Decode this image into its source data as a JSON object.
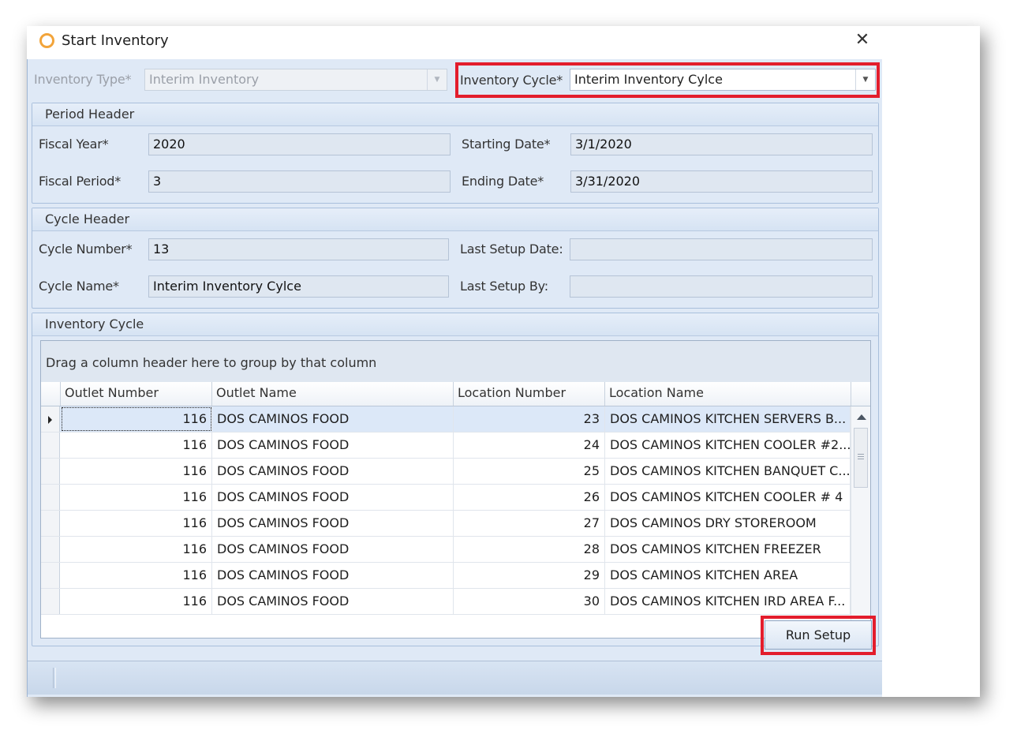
{
  "window": {
    "title": "Start Inventory"
  },
  "top": {
    "inventory_type_label": "Inventory Type*",
    "inventory_type_value": "Interim Inventory",
    "inventory_cycle_label": "Inventory Cycle*",
    "inventory_cycle_value": "Interim Inventory Cylce"
  },
  "period_header": {
    "title": "Period Header",
    "fiscal_year_label": "Fiscal Year*",
    "fiscal_year_value": "2020",
    "fiscal_period_label": "Fiscal Period*",
    "fiscal_period_value": "3",
    "starting_date_label": "Starting Date*",
    "starting_date_value": "3/1/2020",
    "ending_date_label": "Ending Date*",
    "ending_date_value": "3/31/2020"
  },
  "cycle_header": {
    "title": "Cycle Header",
    "cycle_number_label": "Cycle Number*",
    "cycle_number_value": "13",
    "cycle_name_label": "Cycle Name*",
    "cycle_name_value": "Interim Inventory Cylce",
    "last_setup_date_label": "Last Setup Date:",
    "last_setup_date_value": "",
    "last_setup_by_label": "Last Setup By:",
    "last_setup_by_value": ""
  },
  "inventory_cycle": {
    "title": "Inventory Cycle",
    "group_panel_text": "Drag a column header here to group by that column",
    "columns": [
      "Outlet Number",
      "Outlet Name",
      "Location Number",
      "Location Name"
    ],
    "rows": [
      {
        "outlet_number": "116",
        "outlet_name": "DOS CAMINOS FOOD",
        "location_number": "23",
        "location_name": "DOS CAMINOS KITCHEN SERVERS B..."
      },
      {
        "outlet_number": "116",
        "outlet_name": "DOS CAMINOS FOOD",
        "location_number": "24",
        "location_name": "DOS CAMINOS KITCHEN COOLER #2..."
      },
      {
        "outlet_number": "116",
        "outlet_name": "DOS CAMINOS FOOD",
        "location_number": "25",
        "location_name": "DOS CAMINOS KITCHEN BANQUET C..."
      },
      {
        "outlet_number": "116",
        "outlet_name": "DOS CAMINOS FOOD",
        "location_number": "26",
        "location_name": "DOS CAMINOS KITCHEN COOLER # 4"
      },
      {
        "outlet_number": "116",
        "outlet_name": "DOS CAMINOS FOOD",
        "location_number": "27",
        "location_name": "DOS CAMINOS DRY STOREROOM"
      },
      {
        "outlet_number": "116",
        "outlet_name": "DOS CAMINOS FOOD",
        "location_number": "28",
        "location_name": "DOS CAMINOS KITCHEN FREEZER"
      },
      {
        "outlet_number": "116",
        "outlet_name": "DOS CAMINOS FOOD",
        "location_number": "29",
        "location_name": "DOS CAMINOS KITCHEN AREA"
      },
      {
        "outlet_number": "116",
        "outlet_name": "DOS CAMINOS FOOD",
        "location_number": "30",
        "location_name": "DOS CAMINOS KITCHEN IRD AREA F..."
      }
    ]
  },
  "actions": {
    "run_setup_label": "Run Setup"
  },
  "icons": {
    "window_icon": "circle-icon",
    "close": "close-icon",
    "dropdown": "chevron-down-icon"
  },
  "colors": {
    "highlight": "#e31d2c",
    "window_icon": "#f2a43a"
  }
}
